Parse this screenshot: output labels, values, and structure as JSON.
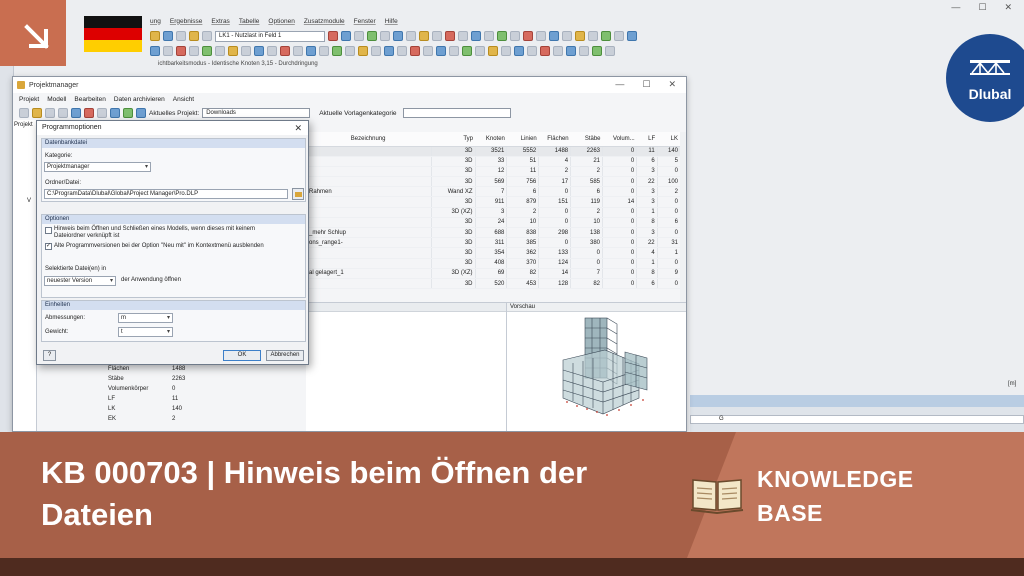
{
  "app": {
    "menu": [
      "ung",
      "Ergebnisse",
      "Extras",
      "Tabelle",
      "Optionen",
      "Zusatzmodule",
      "Fenster",
      "Hilfe"
    ],
    "load_case": "LK1 - Nutzlast in Feld 1",
    "status_text": "ichtbarkeitsmodus - Identische Knoten 3,15 - Durchdringung",
    "unit_label": "[m]",
    "coord_label": "G"
  },
  "logo": {
    "brand": "Dlubal"
  },
  "projektmanager": {
    "title": "Projektmanager",
    "menu": [
      "Projekt",
      "Modell",
      "Bearbeiten",
      "Daten archivieren",
      "Ansicht"
    ],
    "current_project_label": "Aktuelles Projekt:",
    "current_project": "Downloads",
    "template_label": "Aktuelle Vorlagenkategorie",
    "template_value": "",
    "left_tabs": [
      "Projekt",
      "V"
    ],
    "columns": [
      "Bezeichnung",
      "Typ",
      "Knoten",
      "Linien",
      "Flächen",
      "Stäbe",
      "Volum...",
      "LF",
      "LK"
    ],
    "rows": [
      [
        "",
        "3D",
        "3521",
        "5552",
        "1488",
        "2263",
        "0",
        "11",
        "140"
      ],
      [
        "",
        "3D",
        "33",
        "51",
        "4",
        "21",
        "0",
        "6",
        "5"
      ],
      [
        "",
        "3D",
        "12",
        "11",
        "2",
        "2",
        "0",
        "3",
        "0"
      ],
      [
        "",
        "3D",
        "569",
        "756",
        "17",
        "585",
        "0",
        "22",
        "100"
      ],
      [
        "Rahmen",
        "Wand XZ",
        "7",
        "6",
        "0",
        "6",
        "0",
        "3",
        "2"
      ],
      [
        "",
        "3D",
        "911",
        "879",
        "151",
        "119",
        "14",
        "3",
        "0"
      ],
      [
        "",
        "3D (XZ)",
        "3",
        "2",
        "0",
        "2",
        "0",
        "1",
        "0"
      ],
      [
        "",
        "3D",
        "24",
        "10",
        "0",
        "10",
        "0",
        "8",
        "6"
      ],
      [
        "_mehr Schlup",
        "3D",
        "688",
        "838",
        "298",
        "138",
        "0",
        "3",
        "0"
      ],
      [
        "ons_range1-",
        "3D",
        "311",
        "385",
        "0",
        "380",
        "0",
        "22",
        "31"
      ],
      [
        "",
        "3D",
        "354",
        "362",
        "133",
        "0",
        "0",
        "4",
        "1"
      ],
      [
        "",
        "3D",
        "408",
        "370",
        "124",
        "0",
        "0",
        "1",
        "0"
      ],
      [
        "al gelagert_1",
        "3D (XZ)",
        "69",
        "82",
        "14",
        "7",
        "0",
        "8",
        "9"
      ],
      [
        "",
        "3D",
        "520",
        "453",
        "128",
        "82",
        "0",
        "6",
        "0"
      ]
    ],
    "preview_label": "Vorschau",
    "properties": [
      {
        "k": "Flächen",
        "v": "1488"
      },
      {
        "k": "Stäbe",
        "v": "2263"
      },
      {
        "k": "Volumenkörper",
        "v": "0"
      },
      {
        "k": "LF",
        "v": "11"
      },
      {
        "k": "LK",
        "v": "140"
      },
      {
        "k": "EK",
        "v": "2"
      }
    ]
  },
  "dialog": {
    "title": "Programmoptionen",
    "db_group": "Datenbankdatei",
    "category_label": "Kategorie:",
    "category_value": "Projektmanager",
    "folder_label": "Ordner/Datei:",
    "folder_value": "C:\\ProgramData\\Dlubal\\Global\\Project Manager\\Pro.DLP",
    "options_group": "Optionen",
    "opt1_text": "Hinweis beim Öffnen und Schließen eines Modells, wenn dieses mit keinem Dateiordner verknüpft ist",
    "opt1_checked": false,
    "opt2_text": "Alte Programmversionen bei der Option \"Neu mit\" im Kontextmenü ausblenden",
    "opt2_checked": true,
    "selected_files_label": "Selektierte Datei(en) in",
    "version_value": "neuester Version",
    "open_with_label": "der Anwendung öffnen",
    "units_group": "Einheiten",
    "dimensions_label": "Abmessungen:",
    "dimensions_value": "m",
    "weight_label": "Gewicht:",
    "weight_value": "t",
    "ok_label": "OK",
    "cancel_label": "Abbrechen"
  },
  "banner": {
    "title": "KB 000703 | Hinweis beim Öffnen der Dateien",
    "label_line1": "KNOWLEDGE",
    "label_line2": "BASE"
  },
  "colors": {
    "banner_dark": "#a76048",
    "banner_light": "#c0765c",
    "corner_tile": "#c96e50",
    "dlubal_blue": "#1e4a8f"
  }
}
